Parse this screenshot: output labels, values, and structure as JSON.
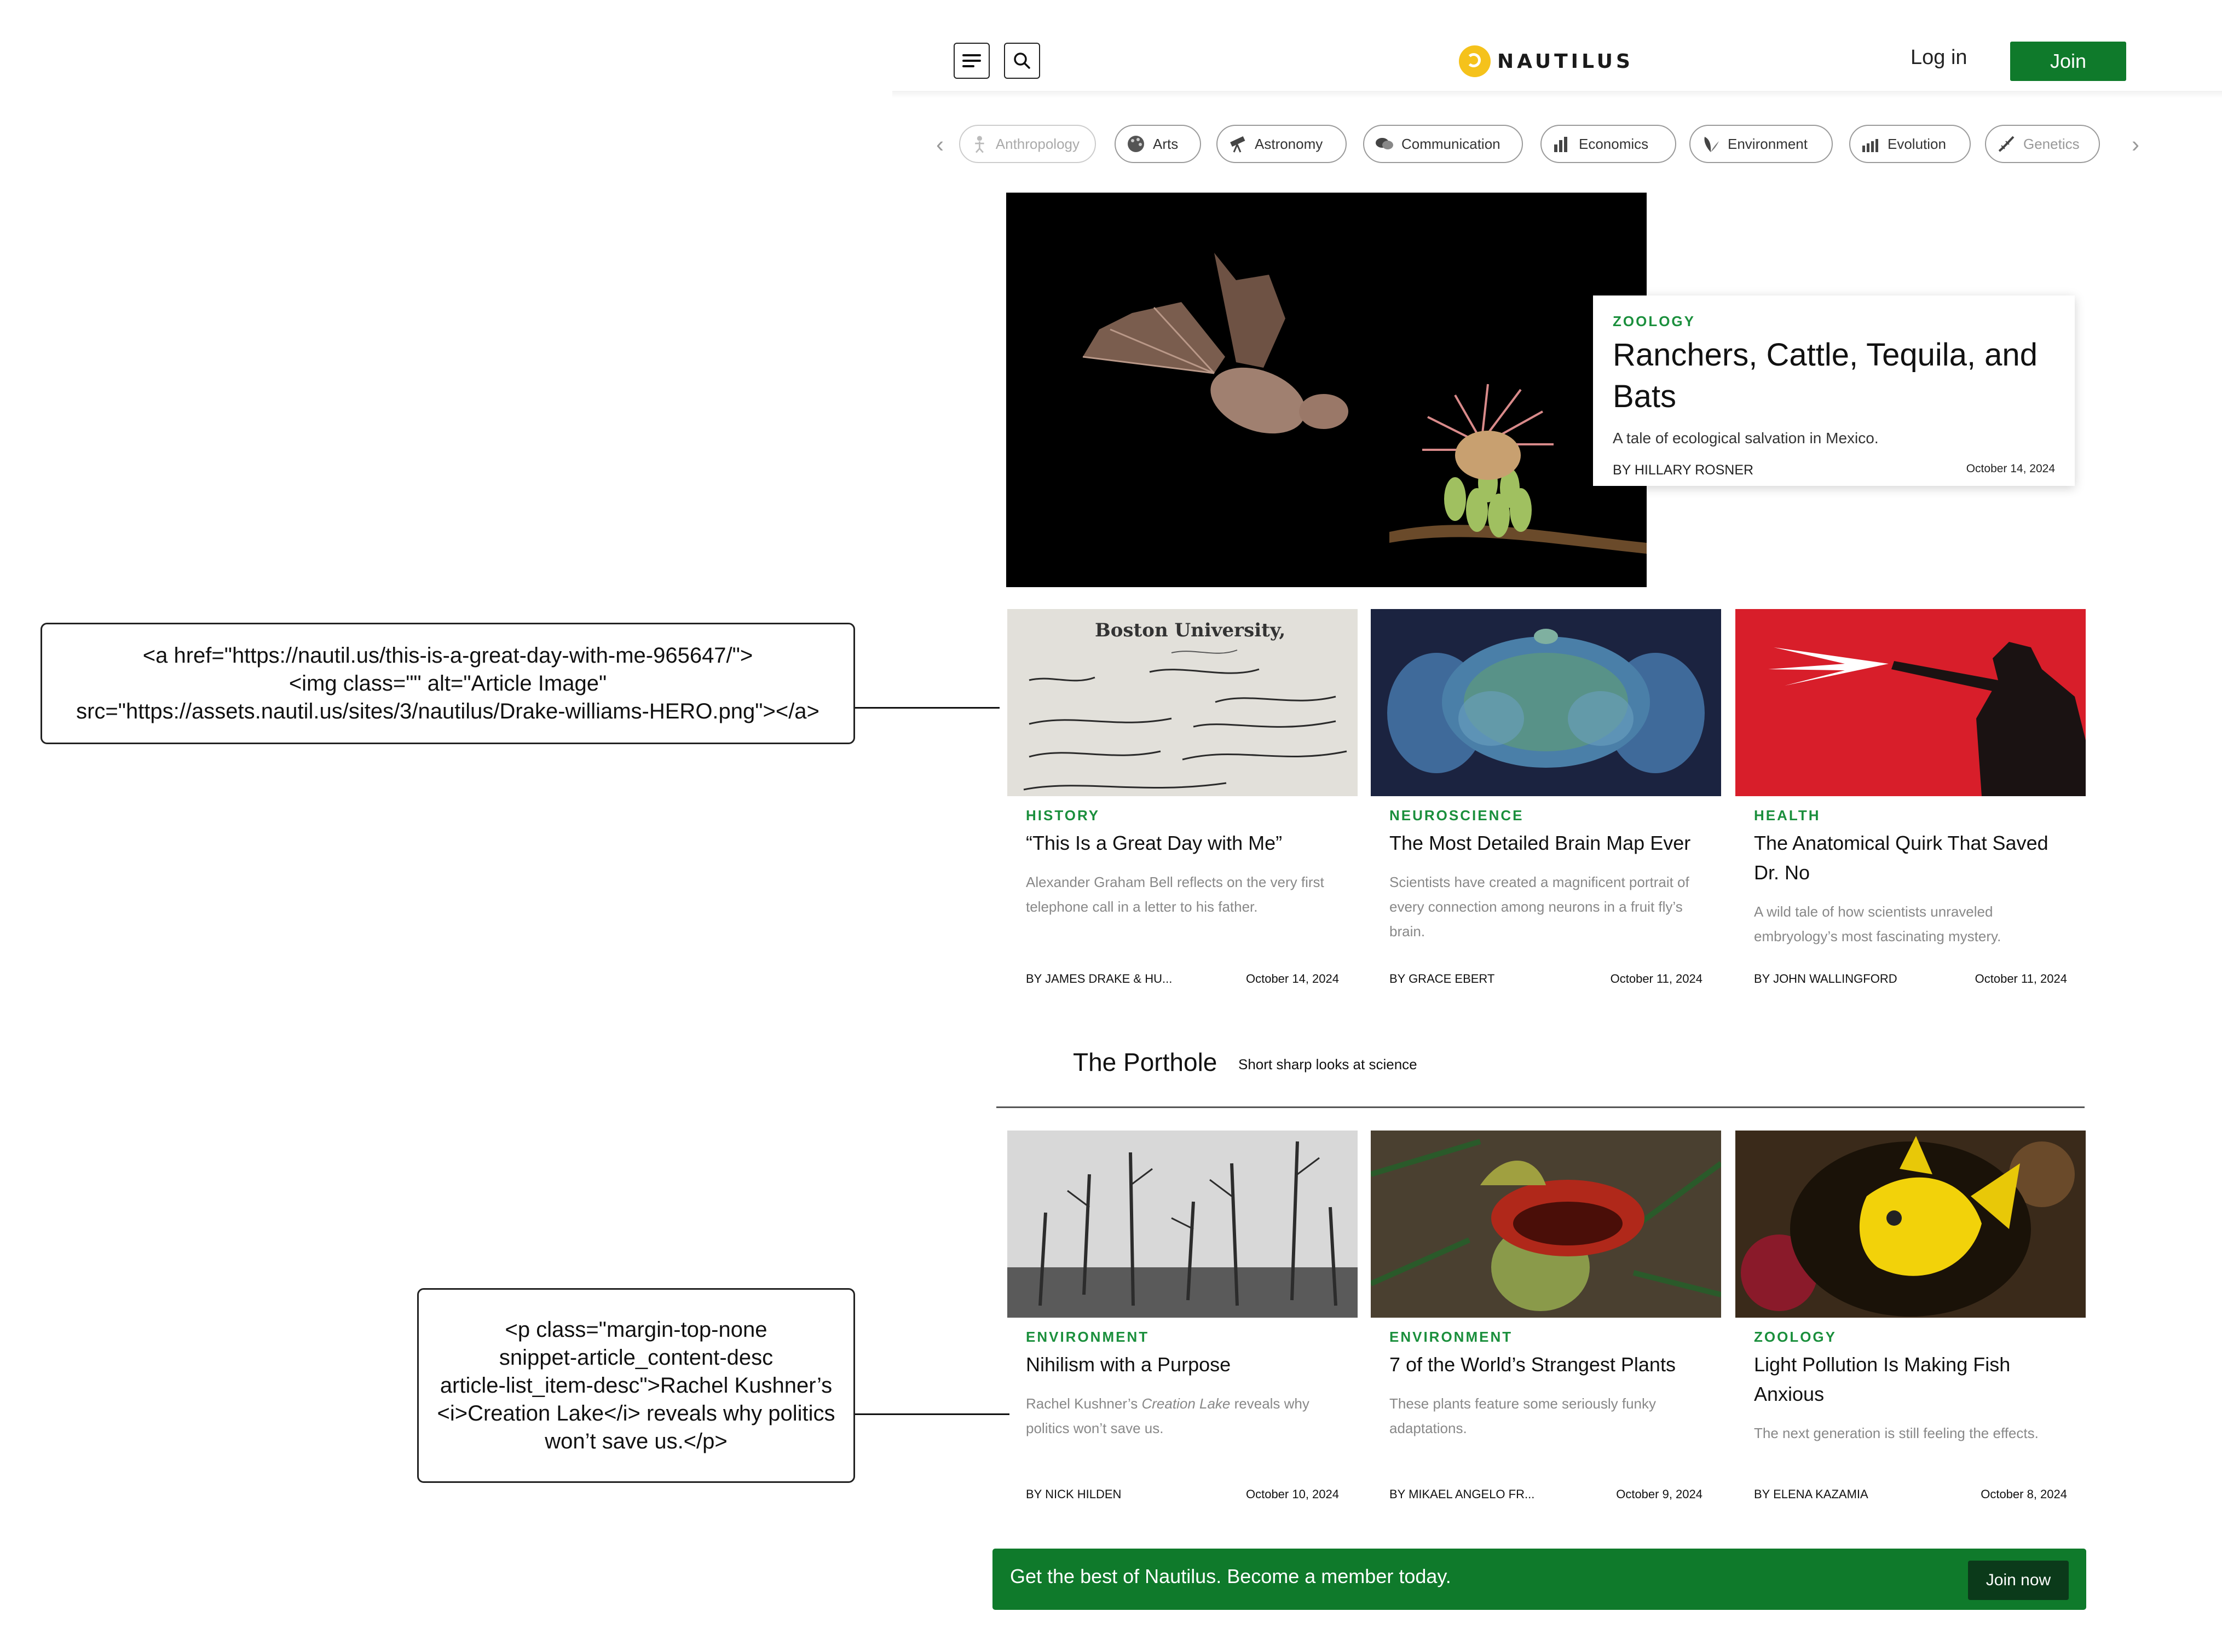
{
  "header": {
    "logo_text": "NAUTILUS",
    "login_label": "Log in",
    "join_label": "Join"
  },
  "categories": [
    {
      "label": "Anthropology",
      "icon": "figure-icon"
    },
    {
      "label": "Arts",
      "icon": "palette-icon"
    },
    {
      "label": "Astronomy",
      "icon": "telescope-icon"
    },
    {
      "label": "Communication",
      "icon": "speech-icon"
    },
    {
      "label": "Economics",
      "icon": "bar-chart-icon"
    },
    {
      "label": "Environment",
      "icon": "leaf-icon"
    },
    {
      "label": "Evolution",
      "icon": "evolution-icon"
    },
    {
      "label": "Genetics",
      "icon": "dna-icon"
    }
  ],
  "hero": {
    "category": "ZOOLOGY",
    "title": "Ranchers, Cattle, Tequila, and Bats",
    "description": "A tale of ecological salvation in Mexico.",
    "author": "BY HILLARY ROSNER",
    "date": "October 14, 2024"
  },
  "row1": [
    {
      "category": "HISTORY",
      "title": "“This Is a Great Day with Me”",
      "description": "Alexander Graham Bell reflects on the very first telephone call in a letter to his father.",
      "author": "BY JAMES DRAKE & HU...",
      "date": "October 14, 2024"
    },
    {
      "category": "NEUROSCIENCE",
      "title": "The Most Detailed Brain Map Ever",
      "description": "Scientists have created a magnificent portrait of every connection among neurons in a fruit fly’s brain.",
      "author": "BY GRACE EBERT",
      "date": "October 11, 2024"
    },
    {
      "category": "HEALTH",
      "title": "The Anatomical Quirk That Saved Dr. No",
      "description": "A wild tale of how scientists unraveled embryology’s most fascinating mystery.",
      "author": "BY JOHN WALLINGFORD",
      "date": "October 11, 2024"
    }
  ],
  "porthole": {
    "title": "The Porthole",
    "subtitle": "Short sharp looks at science"
  },
  "row2": [
    {
      "category": "ENVIRONMENT",
      "title": "Nihilism with a Purpose",
      "description_pre": "Rachel Kushner’s ",
      "description_em": "Creation Lake",
      "description_post": " reveals why politics won’t save us.",
      "author": "BY NICK HILDEN",
      "date": "October 10, 2024"
    },
    {
      "category": "ENVIRONMENT",
      "title": "7 of the World’s Strangest Plants",
      "description": "These plants feature some seriously funky adaptations.",
      "author": "BY MIKAEL ANGELO FR...",
      "date": "October 9, 2024"
    },
    {
      "category": "ZOOLOGY",
      "title": "Light Pollution Is Making Fish Anxious",
      "description": "The next generation is still feeling the effects.",
      "author": "BY ELENA KAZAMIA",
      "date": "October 8, 2024"
    }
  ],
  "banner": {
    "text": "Get the best of Nautilus. Become a member today.",
    "button_label": "Join now"
  },
  "annotations": {
    "top": "<a href=\"https://nautil.us/this-is-a-great-day-with-me-965647/\">\n<img class=\"\" alt=\"Article Image\"\nsrc=\"https://assets.nautil.us/sites/3/nautilus/Drake-williams-HERO.png\"></a>",
    "bottom": "<p class=\"margin-top-none\nsnippet-article_content-desc\narticle-list_item-desc\">Rachel Kushner’s\n<i>Creation Lake</i> reveals why politics\nwon’t save us.</p>"
  },
  "colors": {
    "brand_green": "#0f7a2b",
    "category_green": "#1a8f3c",
    "logo_yellow": "#f5c21b"
  }
}
